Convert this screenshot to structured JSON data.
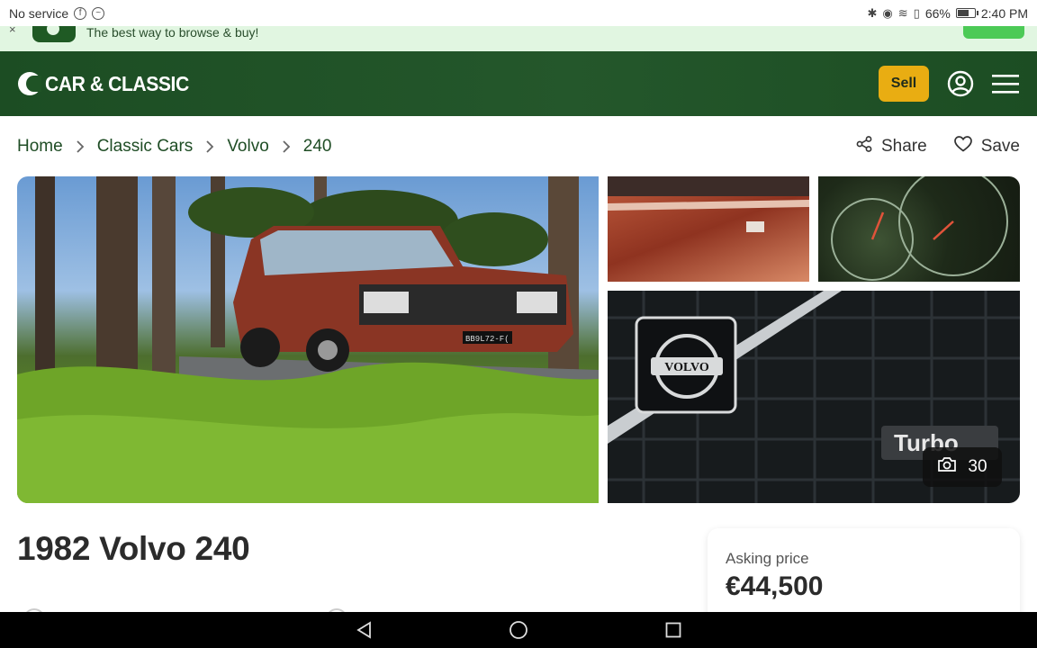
{
  "status_bar": {
    "carrier": "No service",
    "battery": "66%",
    "battery_level": 0.66,
    "time": "2:40 PM"
  },
  "app_banner": {
    "tagline": "The best way to browse & buy!"
  },
  "header": {
    "brand": "CAR & CLASSIC",
    "sell_label": "Sell",
    "colors": {
      "header_bg": "#1f5325",
      "sell_bg": "#e9ad12"
    }
  },
  "breadcrumb": {
    "items": [
      "Home",
      "Classic Cars",
      "Volvo",
      "240"
    ]
  },
  "actions": {
    "share_label": "Share",
    "save_label": "Save"
  },
  "gallery": {
    "photo_count": "30",
    "photos": [
      {
        "label": "main-photo"
      },
      {
        "label": "body-detail-photo"
      },
      {
        "label": "gauge-photo"
      },
      {
        "label": "grille-badge-photo"
      }
    ],
    "visible_text": {
      "plate": "BB9L72-F(",
      "badge": "VOLVO",
      "grille": "Turbo"
    }
  },
  "listing": {
    "title": "1982 Volvo 240",
    "price_label": "Asking price",
    "price": "€44,500"
  }
}
